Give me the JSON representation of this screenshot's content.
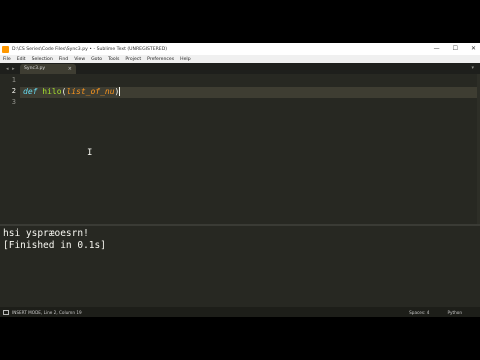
{
  "window": {
    "title": "D:\\CS Series\\Code Files\\Sync3.py • - Sublime Text (UNREGISTERED)",
    "controls": {
      "minimize": "—",
      "maximize": "☐",
      "close": "✕"
    }
  },
  "menu": [
    "File",
    "Edit",
    "Selection",
    "Find",
    "View",
    "Goto",
    "Tools",
    "Project",
    "Preferences",
    "Help"
  ],
  "tabs": {
    "nav_arrows": "◂ ▸",
    "active": {
      "label": "Sync3.py",
      "close": "×"
    },
    "dropdown": "▾"
  },
  "editor": {
    "line_numbers": [
      "1",
      "2",
      "3"
    ],
    "code_line_2": {
      "keyword": "def",
      "function": "hilo",
      "open_paren": "(",
      "param": "list_of_nu",
      "close_paren": ")"
    },
    "mouse_cursor": "I"
  },
  "output": {
    "lines": [
      "hsi yspræoesrn!",
      "[Finished in 0.1s]"
    ]
  },
  "status": {
    "left": "INSERT MODE, Line 2, Column 19",
    "spaces": "Spaces: 4",
    "syntax": "Python"
  }
}
